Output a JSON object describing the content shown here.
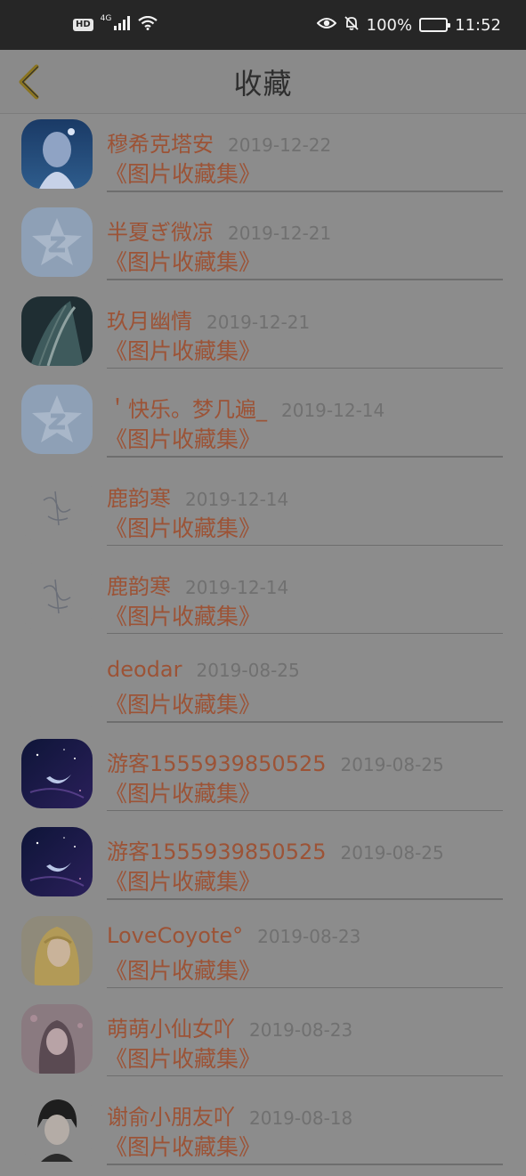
{
  "status_bar": {
    "hd": "HD",
    "network": "4G",
    "battery_text": "100%",
    "time": "11:52"
  },
  "header": {
    "title": "收藏"
  },
  "colors": {
    "accent": "#9c5336",
    "back_arrow": "#8a7420"
  },
  "items": [
    {
      "name": "穆希克塔安",
      "date": "2019-12-22",
      "collection": "《图片收藏集》",
      "avatar": "anime-girl-blue"
    },
    {
      "name": "半夏ぎ微凉",
      "date": "2019-12-21",
      "collection": "《图片收藏集》",
      "avatar": "qzone-star"
    },
    {
      "name": "玖月幽情",
      "date": "2019-12-21",
      "collection": "《图片收藏集》",
      "avatar": "anime-dark-teal"
    },
    {
      "name": "＇快乐。梦几遍_",
      "date": "2019-12-14",
      "collection": "《图片收藏集》",
      "avatar": "qzone-star"
    },
    {
      "name": "鹿韵寒",
      "date": "2019-12-14",
      "collection": "《图片收藏集》",
      "avatar": "calligraphy"
    },
    {
      "name": "鹿韵寒",
      "date": "2019-12-14",
      "collection": "《图片收藏集》",
      "avatar": "calligraphy"
    },
    {
      "name": "deodar",
      "date": "2019-08-25",
      "collection": "《图片收藏集》",
      "avatar": "blank"
    },
    {
      "name": "游客1555939850525",
      "date": "2019-08-25",
      "collection": "《图片收藏集》",
      "avatar": "moon-night"
    },
    {
      "name": "游客1555939850525",
      "date": "2019-08-25",
      "collection": "《图片收藏集》",
      "avatar": "moon-night"
    },
    {
      "name": "LoveCoyote°",
      "date": "2019-08-23",
      "collection": "《图片收藏集》",
      "avatar": "anime-blonde"
    },
    {
      "name": "萌萌小仙女吖",
      "date": "2019-08-23",
      "collection": "《图片收藏集》",
      "avatar": "anime-pink"
    },
    {
      "name": "谢俞小朋友吖",
      "date": "2019-08-18",
      "collection": "《图片收藏集》",
      "avatar": "anime-dark-boy"
    }
  ]
}
